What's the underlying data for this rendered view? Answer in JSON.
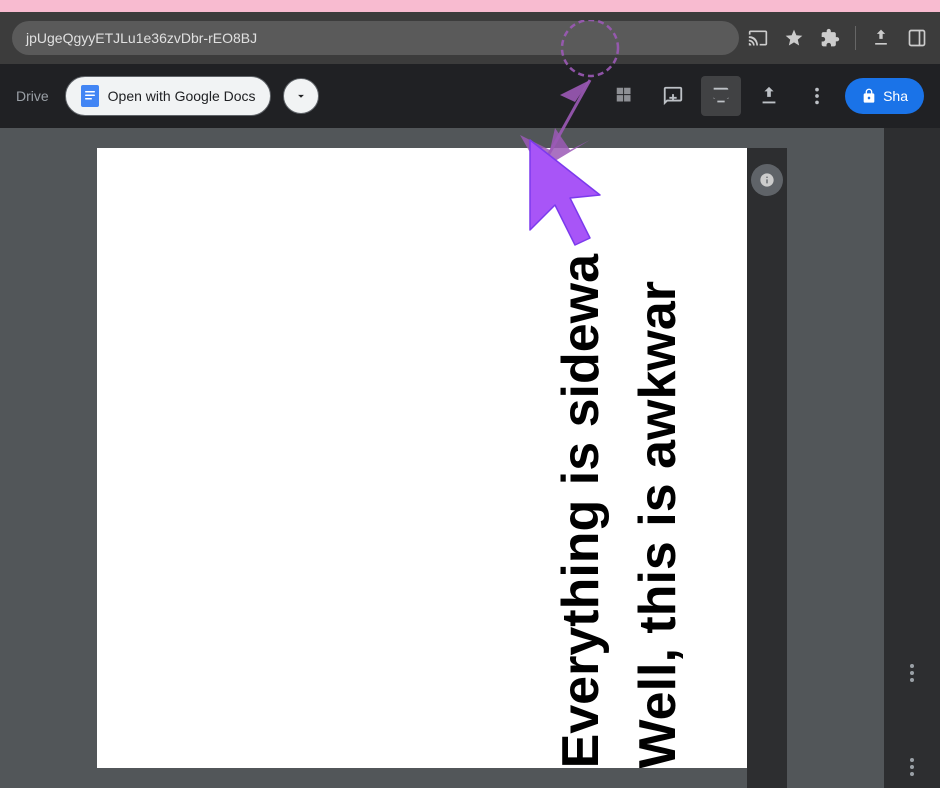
{
  "browser": {
    "address_bar_text": "jpUgeQgyyETJLu1e36zvDbr-rEO8BJ",
    "icons": [
      "cast-icon",
      "star-icon",
      "extension-icon",
      "download-icon",
      "sidebar-icon"
    ]
  },
  "toolbar": {
    "drive_label": "Drive",
    "open_with_label": "Open with Google Docs",
    "dropdown_icon": "▾",
    "share_label": "Sha",
    "share_lock_icon": "🔒"
  },
  "document": {
    "rotated_text_1": "Everything is sidewa",
    "rotated_text_2": "Well, this is awkwar"
  },
  "annotation": {
    "color": "#9b59b6"
  }
}
